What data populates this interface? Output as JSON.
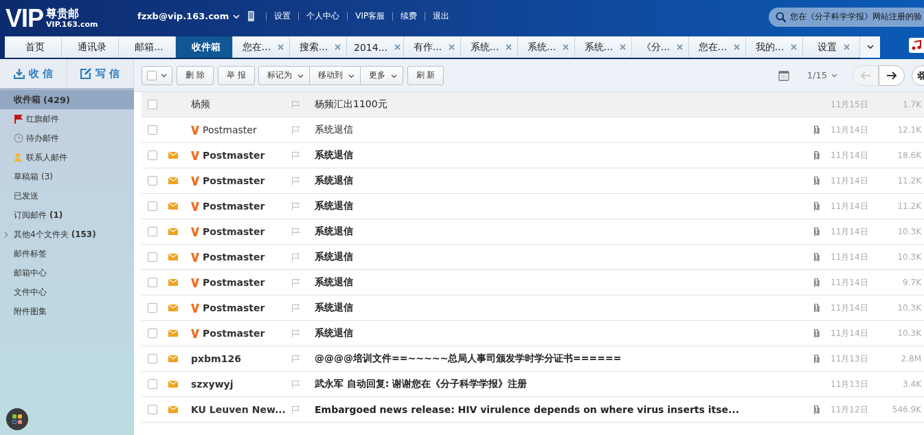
{
  "header": {
    "logo_big": "VIP",
    "logo_cn": "尊贵邮",
    "logo_url": "VIP.163.com",
    "account": "fzxb@vip.163.com",
    "links": [
      "设置",
      "个人中心",
      "VIP客服",
      "续费",
      "退出"
    ],
    "search": {
      "value": "您在《分子科学学报》网站注册的验"
    }
  },
  "tabs": [
    {
      "label": "首页",
      "closable": false,
      "selected": false
    },
    {
      "label": "通讯录",
      "closable": false,
      "selected": false
    },
    {
      "label": "邮箱...",
      "closable": false,
      "selected": false
    },
    {
      "label": "收件箱",
      "closable": false,
      "selected": true
    },
    {
      "label": "您在...",
      "closable": true,
      "selected": false
    },
    {
      "label": "搜索...",
      "closable": true,
      "selected": false
    },
    {
      "label": "2014...",
      "closable": true,
      "selected": false
    },
    {
      "label": "有作...",
      "closable": true,
      "selected": false
    },
    {
      "label": "系统...",
      "closable": true,
      "selected": false
    },
    {
      "label": "系统...",
      "closable": true,
      "selected": false
    },
    {
      "label": "系统...",
      "closable": true,
      "selected": false
    },
    {
      "label": "《分...",
      "closable": true,
      "selected": false
    },
    {
      "label": "您在...",
      "closable": true,
      "selected": false
    },
    {
      "label": "我的...",
      "closable": true,
      "selected": false
    },
    {
      "label": "设置",
      "closable": true,
      "selected": false
    }
  ],
  "sidebar": {
    "receive": "收 信",
    "compose": "写 信",
    "items": [
      {
        "kind": "plain",
        "label": "收件箱",
        "count": "(429)",
        "bold": true,
        "selected": true
      },
      {
        "kind": "flag",
        "label": "红旗邮件",
        "selected": false
      },
      {
        "kind": "clock",
        "label": "待办邮件",
        "selected": false
      },
      {
        "kind": "contact",
        "label": "联系人邮件",
        "selected": false
      },
      {
        "kind": "plain",
        "label": "草稿箱",
        "count": "(3)",
        "bold": false,
        "selected": false
      },
      {
        "kind": "plain",
        "label": "已发送",
        "selected": false
      },
      {
        "kind": "plain",
        "label": "订阅邮件",
        "count": "(1)",
        "bold": true,
        "selected": false
      },
      {
        "kind": "group",
        "label": "其他4个文件夹",
        "count": "(153)",
        "bold": true,
        "expanded": false,
        "selected": false
      },
      {
        "kind": "plain",
        "label": "邮件标签",
        "selected": false
      },
      {
        "kind": "plain",
        "label": "邮箱中心",
        "selected": false
      },
      {
        "kind": "plain",
        "label": "文件中心",
        "selected": false
      },
      {
        "kind": "plain",
        "label": "附件图集",
        "selected": false
      }
    ]
  },
  "toolbar": {
    "select_all_checked": false,
    "buttons": [
      {
        "label": "删 除",
        "dropdown": false
      },
      {
        "label": "举 报",
        "dropdown": false
      }
    ],
    "menus": [
      "标记为",
      "移动到",
      "更多"
    ],
    "refresh": "刷 新",
    "page": "1/15"
  },
  "messages": [
    {
      "checked": false,
      "unread": false,
      "vip": false,
      "sender": "杨频",
      "subject": "杨频汇出1100元",
      "attachment": false,
      "date": "11月15日",
      "size": "1.7K",
      "highlighted": true
    },
    {
      "checked": false,
      "unread": false,
      "vip": true,
      "sender": "Postmaster",
      "subject": "系统退信",
      "attachment": true,
      "date": "11月14日",
      "size": "12.1K",
      "highlighted": false
    },
    {
      "checked": false,
      "unread": true,
      "vip": true,
      "sender": "Postmaster",
      "subject": "系统退信",
      "attachment": true,
      "date": "11月14日",
      "size": "18.6K",
      "highlighted": false
    },
    {
      "checked": false,
      "unread": true,
      "vip": true,
      "sender": "Postmaster",
      "subject": "系统退信",
      "attachment": true,
      "date": "11月14日",
      "size": "11.2K",
      "highlighted": false
    },
    {
      "checked": false,
      "unread": true,
      "vip": true,
      "sender": "Postmaster",
      "subject": "系统退信",
      "attachment": true,
      "date": "11月14日",
      "size": "11.2K",
      "highlighted": false
    },
    {
      "checked": false,
      "unread": true,
      "vip": true,
      "sender": "Postmaster",
      "subject": "系统退信",
      "attachment": true,
      "date": "11月14日",
      "size": "10.3K",
      "highlighted": false
    },
    {
      "checked": false,
      "unread": true,
      "vip": true,
      "sender": "Postmaster",
      "subject": "系统退信",
      "attachment": true,
      "date": "11月14日",
      "size": "10.3K",
      "highlighted": false
    },
    {
      "checked": false,
      "unread": true,
      "vip": true,
      "sender": "Postmaster",
      "subject": "系统退信",
      "attachment": true,
      "date": "11月14日",
      "size": "9.7K",
      "highlighted": false
    },
    {
      "checked": false,
      "unread": true,
      "vip": true,
      "sender": "Postmaster",
      "subject": "系统退信",
      "attachment": true,
      "date": "11月14日",
      "size": "10.3K",
      "highlighted": false
    },
    {
      "checked": false,
      "unread": true,
      "vip": true,
      "sender": "Postmaster",
      "subject": "系统退信",
      "attachment": true,
      "date": "11月14日",
      "size": "10.3K",
      "highlighted": false
    },
    {
      "checked": false,
      "unread": true,
      "vip": false,
      "sender": "pxbm126",
      "subject": "@@@@培训文件==~~~~~总局人事司颁发学时学分证书======",
      "attachment": true,
      "date": "11月13日",
      "size": "2.8M",
      "highlighted": false
    },
    {
      "checked": false,
      "unread": true,
      "vip": false,
      "sender": "szxywyj",
      "subject": "武永军 自动回复: 谢谢您在《分子科学学报》注册",
      "attachment": false,
      "date": "11月13日",
      "size": "3.4K",
      "highlighted": false
    },
    {
      "checked": false,
      "unread": true,
      "vip": false,
      "sender": "KU Leuven New...",
      "subject": "Embargoed news release: HIV virulence depends on where virus inserts itse...",
      "attachment": true,
      "date": "11月12日",
      "size": "546.9K",
      "highlighted": false
    }
  ]
}
